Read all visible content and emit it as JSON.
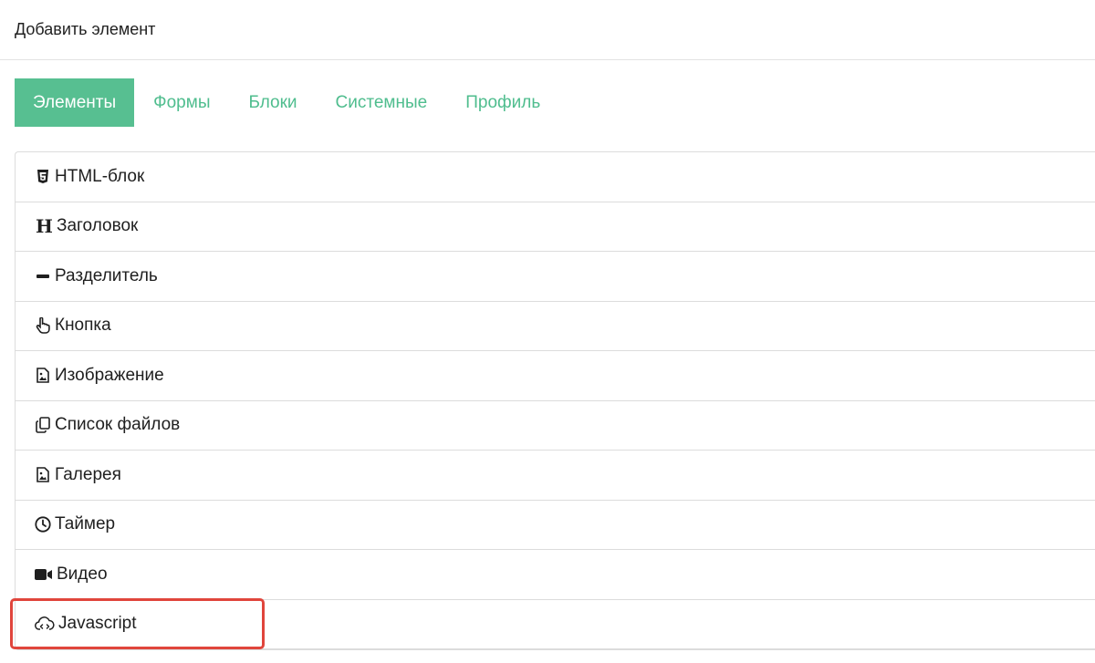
{
  "header": {
    "title": "Добавить элемент"
  },
  "tabs": [
    {
      "label": "Элементы",
      "active": true
    },
    {
      "label": "Формы",
      "active": false
    },
    {
      "label": "Блоки",
      "active": false
    },
    {
      "label": "Системные",
      "active": false
    },
    {
      "label": "Профиль",
      "active": false
    }
  ],
  "elements": [
    {
      "label": "HTML-блок",
      "icon": "html5-icon"
    },
    {
      "label": "Заголовок",
      "icon": "heading-icon"
    },
    {
      "label": "Разделитель",
      "icon": "minus-icon"
    },
    {
      "label": "Кнопка",
      "icon": "hand-pointer-icon"
    },
    {
      "label": "Изображение",
      "icon": "file-image-icon"
    },
    {
      "label": "Список файлов",
      "icon": "copy-icon"
    },
    {
      "label": "Галерея",
      "icon": "file-image-icon"
    },
    {
      "label": "Таймер",
      "icon": "clock-icon"
    },
    {
      "label": "Видео",
      "icon": "video-camera-icon"
    },
    {
      "label": "Javascript",
      "icon": "cloud-code-icon"
    }
  ],
  "colors": {
    "accent": "#57bf91",
    "tab_text": "#4fbd8e",
    "highlight": "#e0453c"
  }
}
